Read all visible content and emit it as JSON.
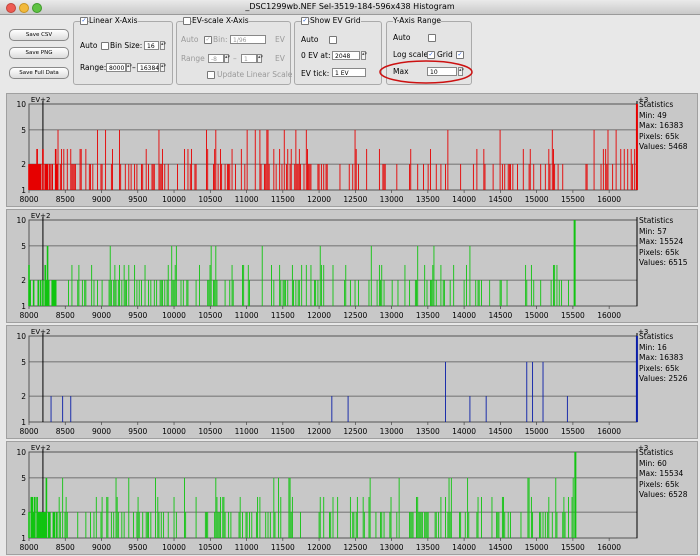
{
  "window": {
    "title": "_DSC1299wb.NEF Sel-3519-184-596x438 Histogram"
  },
  "buttons": {
    "save_csv": "Save CSV",
    "save_png": "Save PNG",
    "save_full": "Save Full Data"
  },
  "linear_x": {
    "title": "Linear X-Axis",
    "checked": true,
    "auto_label": "Auto",
    "bin_size_label": "Bin Size:",
    "bin_size_value": "16",
    "range_label": "Range:",
    "range_min": "8000",
    "range_max": "16384"
  },
  "ev_x": {
    "title": "EV-scale X-Axis",
    "checked": false,
    "auto_label": "Auto",
    "bin_label": "Bin:",
    "bin_value": "1/96",
    "range_label": "Range",
    "range_min": "-8",
    "range_max": "1",
    "ev_unit": "EV",
    "update_label": "Update Linear Scale"
  },
  "ev_grid": {
    "title": "Show EV Grid",
    "checked": true,
    "auto_label": "Auto",
    "zero_ev_label": "0 EV at:",
    "zero_ev_value": "2048",
    "ev_tick_label": "EV tick:",
    "ev_tick_value": "1 EV"
  },
  "y_range": {
    "title": "Y-Axis Range",
    "auto_label": "Auto",
    "log_label": "Log scale",
    "grid_label": "Grid",
    "max_label": "Max",
    "max_value": "10",
    "highlight_color": "#cc1111"
  },
  "chart_data": [
    {
      "type": "bar",
      "series": [
        {
          "name": "Red channel",
          "color": "#e60000"
        }
      ],
      "ev_left": "EV+2",
      "ev_right": "+3",
      "xlim": [
        8000,
        16384
      ],
      "ylim": [
        1,
        10
      ],
      "log_y": true,
      "yticks": [
        "10",
        "5",
        "2",
        "1"
      ],
      "xticks": [
        "8000",
        "8500",
        "9000",
        "9500",
        "10000",
        "10500",
        "11000",
        "11500",
        "12000",
        "12500",
        "13000",
        "13500",
        "14000",
        "14500",
        "15000",
        "15500",
        "16000"
      ],
      "stats": {
        "title": "Statistics",
        "min": "Min: 49",
        "max": "Max: 16383",
        "pixels": "Pixels: 65k",
        "values": "Values: 5468"
      }
    },
    {
      "type": "bar",
      "series": [
        {
          "name": "Green channel",
          "color": "#11c411"
        }
      ],
      "ev_left": "EV+2",
      "ev_right": "",
      "xlim": [
        8000,
        16384
      ],
      "ylim": [
        1,
        10
      ],
      "log_y": true,
      "yticks": [
        "10",
        "5",
        "2",
        "1"
      ],
      "xticks": [
        "8000",
        "8500",
        "9000",
        "9500",
        "10000",
        "10500",
        "11000",
        "11500",
        "12000",
        "12500",
        "13000",
        "13500",
        "14000",
        "14500",
        "15000",
        "15500",
        "16000"
      ],
      "stats": {
        "title": "Statistics",
        "min": "Min: 57",
        "max": "Max: 15524",
        "pixels": "Pixels: 65k",
        "values": "Values: 6515"
      }
    },
    {
      "type": "bar",
      "series": [
        {
          "name": "Blue channel",
          "color": "#0a1ea8"
        }
      ],
      "ev_left": "EV+2",
      "ev_right": "+3",
      "xlim": [
        8000,
        16384
      ],
      "ylim": [
        1,
        10
      ],
      "log_y": true,
      "yticks": [
        "10",
        "5",
        "2",
        "1"
      ],
      "xticks": [
        "8000",
        "8500",
        "9000",
        "9500",
        "10000",
        "10500",
        "11000",
        "11500",
        "12000",
        "12500",
        "13000",
        "13500",
        "14000",
        "14500",
        "15000",
        "15500",
        "16000"
      ],
      "stats": {
        "title": "Statistics",
        "min": "Min: 16",
        "max": "Max: 16383",
        "pixels": "Pixels: 65k",
        "values": "Values: 2526"
      }
    },
    {
      "type": "bar",
      "series": [
        {
          "name": "Green2 channel",
          "color": "#11c411"
        }
      ],
      "ev_left": "EV+2",
      "ev_right": "+3",
      "xlim": [
        8000,
        16384
      ],
      "ylim": [
        1,
        10
      ],
      "log_y": true,
      "yticks": [
        "10",
        "5",
        "2",
        "1"
      ],
      "xticks": [
        "8000",
        "8500",
        "9000",
        "9500",
        "10000",
        "10500",
        "11000",
        "11500",
        "12000",
        "12500",
        "13000",
        "13500",
        "14000",
        "14500",
        "15000",
        "15500",
        "16000"
      ],
      "stats": {
        "title": "Statistics",
        "min": "Min: 60",
        "max": "Max: 15534",
        "pixels": "Pixels: 65k",
        "values": "Values: 6528"
      }
    }
  ]
}
